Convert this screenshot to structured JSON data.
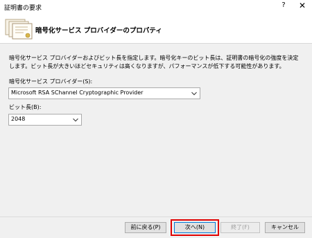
{
  "window": {
    "title": "証明書の要求",
    "help_label": "?",
    "close_label": "✕"
  },
  "header": {
    "title": "暗号化サービス プロバイダーのプロパティ",
    "icon": "certificate-icon"
  },
  "main": {
    "description": "暗号化サービス プロバイダーおよびビット長を指定します。暗号化キーのビット長は、証明書の暗号化の強度を決定します。ビット長が大きいほどセキュリティは高くなりますが、パフォーマンスが低下する可能性があります。",
    "provider_label": "暗号化サービス プロバイダー(S):",
    "provider_value": "Microsoft RSA SChannel Cryptographic Provider",
    "bitlength_label": "ビット長(B):",
    "bitlength_value": "2048"
  },
  "footer": {
    "back_label": "前に戻る(P)",
    "next_label": "次へ(N)",
    "finish_label": "終了(F)",
    "cancel_label": "キャンセル"
  },
  "colors": {
    "highlight": "#e00000",
    "primary_border": "#0078d7"
  }
}
